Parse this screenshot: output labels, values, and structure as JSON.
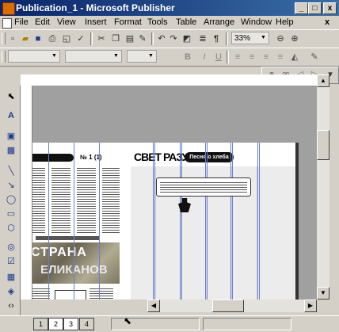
{
  "window": {
    "title": "Publication_1 - Microsoft Publisher",
    "buttons": {
      "minimize": "_",
      "maximize": "□",
      "close": "x"
    }
  },
  "menu": {
    "doc_icon": "document-icon",
    "items": [
      {
        "label": "File",
        "underline": "F"
      },
      {
        "label": "Edit",
        "underline": "E"
      },
      {
        "label": "View",
        "underline": "V"
      },
      {
        "label": "Insert",
        "underline": "I"
      },
      {
        "label": "Format",
        "underline": "o"
      },
      {
        "label": "Tools",
        "underline": "T"
      },
      {
        "label": "Table",
        "underline": "a"
      },
      {
        "label": "Arrange",
        "underline": "A"
      },
      {
        "label": "Window",
        "underline": "W"
      },
      {
        "label": "Help",
        "underline": "H"
      }
    ],
    "close_doc": "x"
  },
  "standard_toolbar": {
    "zoom": "33%",
    "icons": [
      "new-icon",
      "open-icon",
      "save-icon",
      "print-icon",
      "print-preview-icon",
      "spelling-icon",
      "cut-icon",
      "copy-icon",
      "paste-icon",
      "format-painter-icon",
      "undo-icon",
      "redo-icon",
      "send-to-back-icon",
      "columns-icon",
      "show-special-chars-icon",
      "zoom-out-icon",
      "zoom-in-icon"
    ]
  },
  "formatting_toolbar": {
    "style": "",
    "font": "",
    "size": "",
    "icons": [
      "bold-icon",
      "italic-icon",
      "underline-icon",
      "align-left-icon",
      "align-center-icon",
      "align-right-icon",
      "justify-icon",
      "fill-color-icon",
      "line-color-icon"
    ]
  },
  "toolbox": {
    "tools": [
      "pointer-icon",
      "text-frame-icon",
      "table-frame-icon",
      "wordart-icon",
      "picture-frame-icon",
      "clipart-icon",
      "line-icon",
      "oval-icon",
      "rectangle-icon",
      "custom-shapes-icon",
      "hotspot-icon",
      "form-control-icon",
      "html-fragment-icon",
      "design-gallery-icon"
    ]
  },
  "document": {
    "left_page": {
      "heading": "",
      "page_label": "№ 1 (1)",
      "caption": "",
      "picture_line1": "СТРАНА",
      "picture_line2": "ЕЛИКАНОВ"
    },
    "right_page": {
      "masthead": "СВЕТ РАЗУМА",
      "heading": "Песня о хлеба"
    }
  },
  "statusbar": {
    "pages": [
      "1",
      "2",
      "3",
      "4"
    ],
    "active_pages": [
      "2",
      "3"
    ]
  }
}
